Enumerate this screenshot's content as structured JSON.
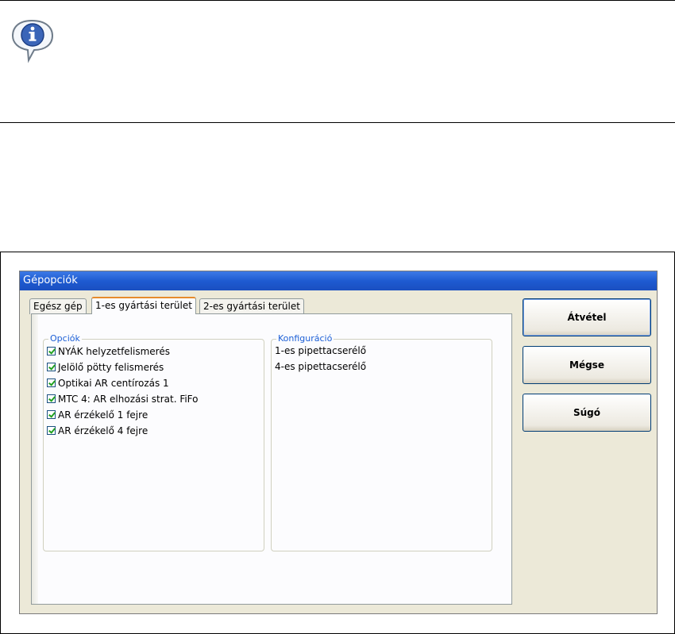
{
  "note": {
    "icon": "info-callout-icon"
  },
  "dialog": {
    "title": "Gépopciók",
    "tabs": [
      {
        "label": "Egész gép",
        "active": false
      },
      {
        "label": "1-es gyártási terület",
        "active": true
      },
      {
        "label": "2-es gyártási terület",
        "active": false
      }
    ],
    "options_group": {
      "legend": "Opciók",
      "items": [
        {
          "label": "NYÁK helyzetfelismerés",
          "checked": true
        },
        {
          "label": "Jelölő pötty felismerés",
          "checked": true
        },
        {
          "label": "Optikai AR centírozás 1",
          "checked": true
        },
        {
          "label": "MTC 4: AR elhozási strat. FiFo",
          "checked": true
        },
        {
          "label": "AR érzékelő 1 fejre",
          "checked": true
        },
        {
          "label": "AR érzékelő 4 fejre",
          "checked": true
        }
      ]
    },
    "config_group": {
      "legend": "Konfiguráció",
      "items": [
        "1-es pipettacserélő",
        "4-es pipettacserélő"
      ]
    },
    "buttons": {
      "accept": "Átvétel",
      "cancel": "Mégse",
      "help": "Súgó"
    }
  },
  "colors": {
    "title_bar": "#1e5bd1",
    "legend_text": "#1c5fd6",
    "active_tab_accent": "#e68b2c",
    "dialog_bg": "#ece9d8"
  }
}
